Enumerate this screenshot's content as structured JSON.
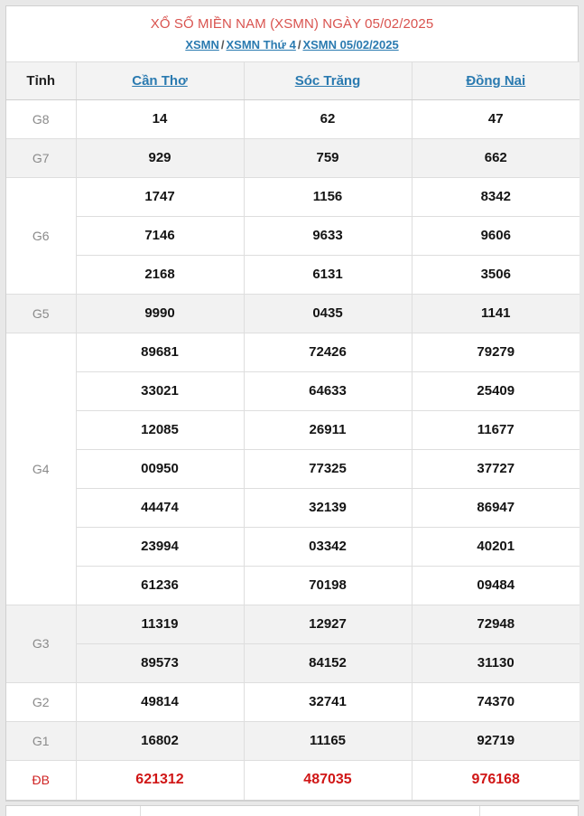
{
  "header": {
    "title": "XỔ SỐ MIỀN NAM (XSMN) NGÀY 05/02/2025",
    "title_color": "#d9534f",
    "breadcrumb": [
      {
        "label": "XSMN"
      },
      {
        "label": "XSMN Thứ 4"
      },
      {
        "label": "XSMN 05/02/2025"
      }
    ],
    "breadcrumb_separator": "/",
    "link_color": "#2a7ab0"
  },
  "table": {
    "columns": [
      {
        "label": "Tỉnh",
        "type": "label"
      },
      {
        "label": "Cần Thơ",
        "type": "province-link"
      },
      {
        "label": "Sóc Trăng",
        "type": "province-link"
      },
      {
        "label": "Đồng Nai",
        "type": "province-link"
      }
    ],
    "special_color": "#d01616",
    "rows": [
      {
        "label": "G8",
        "shaded": false,
        "values": [
          [
            "14",
            "62",
            "47"
          ]
        ]
      },
      {
        "label": "G7",
        "shaded": true,
        "values": [
          [
            "929",
            "759",
            "662"
          ]
        ]
      },
      {
        "label": "G6",
        "shaded": false,
        "values": [
          [
            "1747",
            "1156",
            "8342"
          ],
          [
            "7146",
            "9633",
            "9606"
          ],
          [
            "2168",
            "6131",
            "3506"
          ]
        ]
      },
      {
        "label": "G5",
        "shaded": true,
        "values": [
          [
            "9990",
            "0435",
            "1141"
          ]
        ]
      },
      {
        "label": "G4",
        "shaded": false,
        "values": [
          [
            "89681",
            "72426",
            "79279"
          ],
          [
            "33021",
            "64633",
            "25409"
          ],
          [
            "12085",
            "26911",
            "11677"
          ],
          [
            "00950",
            "77325",
            "37727"
          ],
          [
            "44474",
            "32139",
            "86947"
          ],
          [
            "23994",
            "03342",
            "40201"
          ],
          [
            "61236",
            "70198",
            "09484"
          ]
        ]
      },
      {
        "label": "G3",
        "shaded": true,
        "values": [
          [
            "11319",
            "12927",
            "72948"
          ],
          [
            "89573",
            "84152",
            "31130"
          ]
        ]
      },
      {
        "label": "G2",
        "shaded": false,
        "values": [
          [
            "49814",
            "32741",
            "74370"
          ]
        ]
      },
      {
        "label": "G1",
        "shaded": true,
        "values": [
          [
            "16802",
            "11165",
            "92719"
          ]
        ]
      },
      {
        "label": "ĐB",
        "shaded": false,
        "special": true,
        "values": [
          [
            "621312",
            "487035",
            "976168"
          ]
        ]
      }
    ]
  }
}
